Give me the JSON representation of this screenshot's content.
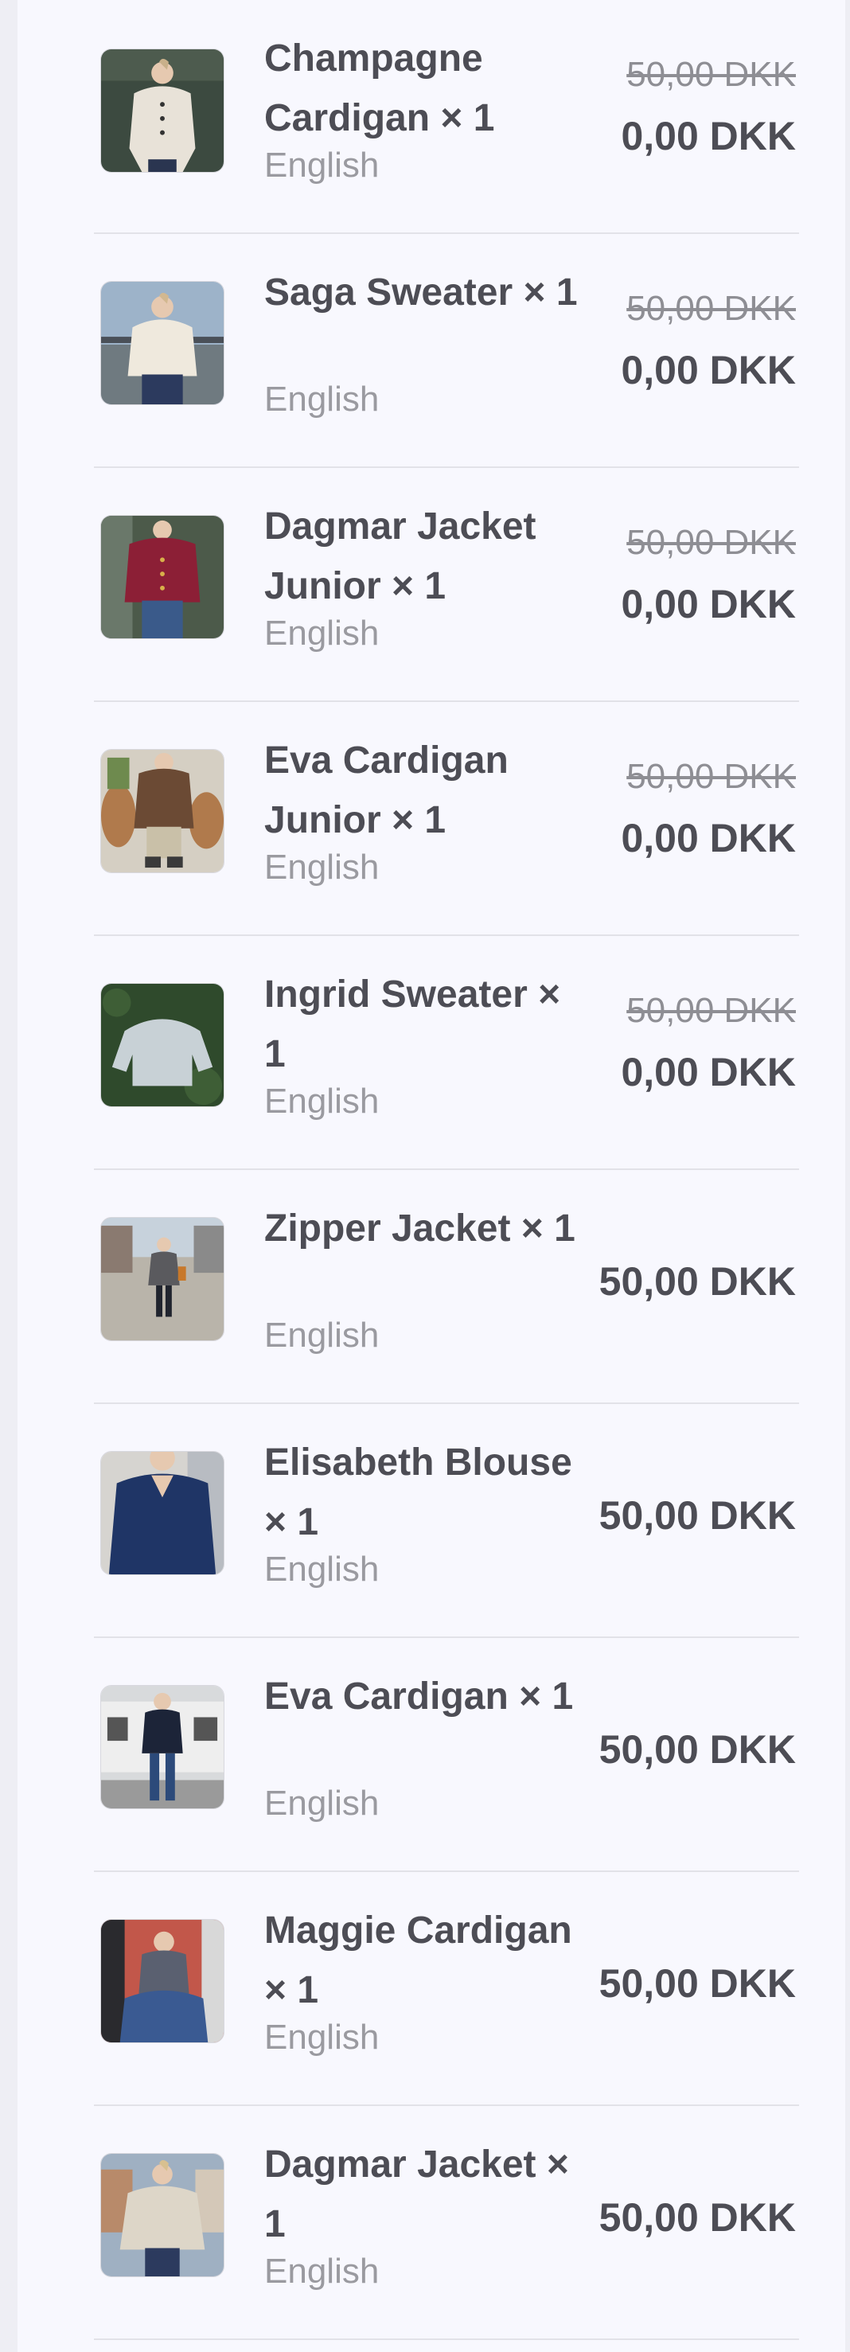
{
  "cart": {
    "items": [
      {
        "name": "Champagne Cardigan × 1",
        "variant": "English",
        "original_price": "50,00 DKK",
        "price": "0,00 DKK",
        "image_icon": "cardigan-photo",
        "colors": {
          "bg": "#3c4a40",
          "garment": "#e8e2d8"
        }
      },
      {
        "name": "Saga Sweater × 1",
        "variant": "English",
        "original_price": "50,00 DKK",
        "price": "0,00 DKK",
        "image_icon": "sweater-photo",
        "colors": {
          "bg": "#9db3c9",
          "garment": "#efe9dd"
        }
      },
      {
        "name": "Dagmar Jacket Junior × 1",
        "variant": "English",
        "original_price": "50,00 DKK",
        "price": "0,00 DKK",
        "image_icon": "jacket-photo",
        "colors": {
          "bg": "#4c5a4a",
          "garment": "#8c1f36"
        }
      },
      {
        "name": "Eva Cardigan Junior × 1",
        "variant": "English",
        "original_price": "50,00 DKK",
        "price": "0,00 DKK",
        "image_icon": "cardigan-photo",
        "colors": {
          "bg": "#d5cfc3",
          "garment": "#6b4a34"
        }
      },
      {
        "name": "Ingrid Sweater × 1",
        "variant": "English",
        "original_price": "50,00 DKK",
        "price": "0,00 DKK",
        "image_icon": "sweater-photo",
        "colors": {
          "bg": "#2f4a2c",
          "garment": "#c8d1d6"
        }
      },
      {
        "name": "Zipper Jacket × 1",
        "variant": "English",
        "original_price": "",
        "price": "50,00 DKK",
        "image_icon": "jacket-photo",
        "colors": {
          "bg": "#b9b4aa",
          "garment": "#5a5a5e"
        }
      },
      {
        "name": "Elisabeth Blouse × 1",
        "variant": "English",
        "original_price": "",
        "price": "50,00 DKK",
        "image_icon": "blouse-photo",
        "colors": {
          "bg": "#d6d4d0",
          "garment": "#1f3566"
        }
      },
      {
        "name": "Eva Cardigan × 1",
        "variant": "English",
        "original_price": "",
        "price": "50,00 DKK",
        "image_icon": "cardigan-photo",
        "colors": {
          "bg": "#d8dadc",
          "garment": "#1c2438"
        }
      },
      {
        "name": "Maggie Cardigan × 1",
        "variant": "English",
        "original_price": "",
        "price": "50,00 DKK",
        "image_icon": "cardigan-photo",
        "colors": {
          "bg": "#c2574a",
          "garment": "#5a6070"
        }
      },
      {
        "name": "Dagmar Jacket × 1",
        "variant": "English",
        "original_price": "",
        "price": "50,00 DKK",
        "image_icon": "jacket-photo",
        "colors": {
          "bg": "#9fb0c2",
          "garment": "#ddd6c8"
        }
      }
    ]
  }
}
